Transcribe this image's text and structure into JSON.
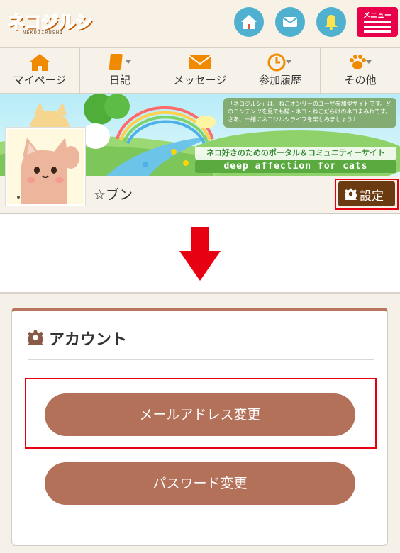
{
  "header": {
    "logo_text": "ネコジルシ",
    "logo_sub": "NEKOJIRUSHI",
    "menu_label": "メニュー",
    "icons": [
      "home-icon",
      "mail-icon",
      "bell-icon"
    ]
  },
  "nav": {
    "items": [
      {
        "label": "マイページ",
        "icon": "home-icon"
      },
      {
        "label": "日記",
        "icon": "diary-icon"
      },
      {
        "label": "メッセージ",
        "icon": "mail-icon"
      },
      {
        "label": "参加履歴",
        "icon": "clock-icon"
      },
      {
        "label": "その他",
        "icon": "paw-icon"
      }
    ]
  },
  "banner": {
    "info_text": "「ネコジルシ」は、ねこオンリーのユーザ参加型サイトです。どのコンテンツを見ても猫・ネコ・ねこだらけのネコまみれです。さあ、一緒にネコジルシライフを楽しみましょう♪",
    "tagline": "ネコ好きのためのポータル＆コミュニティーサイト",
    "tagline_en": "deep affection for cats"
  },
  "profile": {
    "username": "☆ブン",
    "settings_label": "設定"
  },
  "account": {
    "title": "アカウント",
    "email_change_label": "メールアドレス変更",
    "password_change_label": "パスワード変更"
  },
  "colors": {
    "header_bg": "#f7f1e6",
    "circle_btn": "#4fb0cf",
    "menu_btn": "#e8004a",
    "settings_btn": "#6b3a10",
    "pill_btn": "#b3715a",
    "highlight": "#e60012",
    "nav_icon": "#f08a00"
  }
}
